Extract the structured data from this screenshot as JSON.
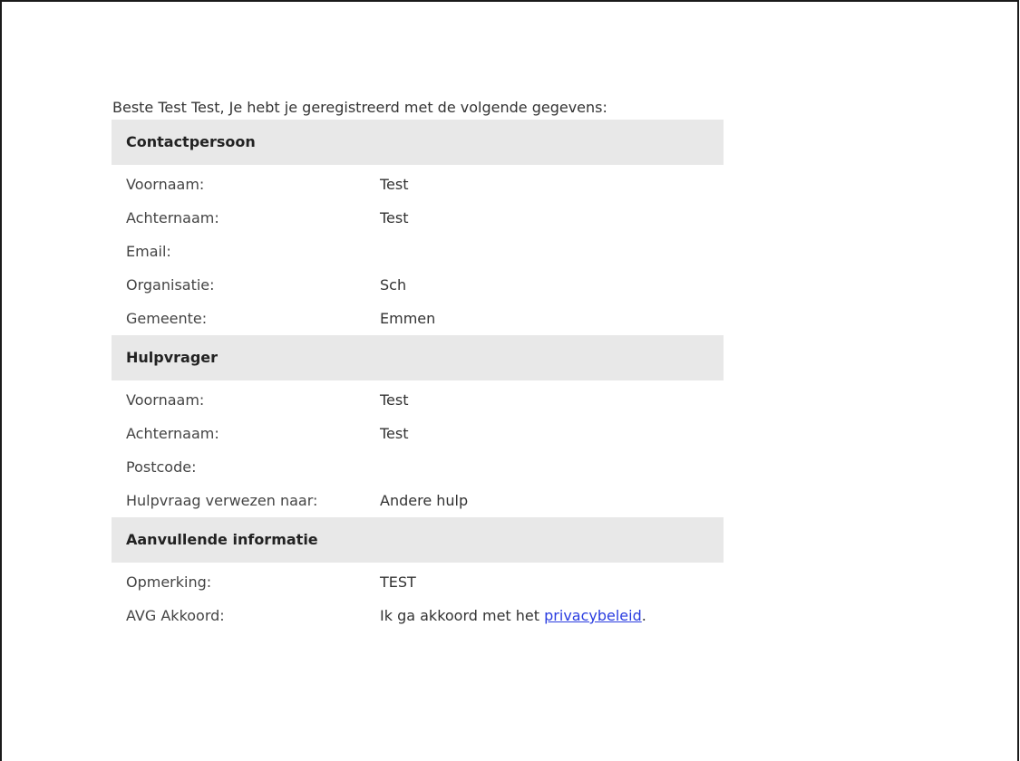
{
  "intro": "Beste Test Test, Je hebt je geregistreerd met de volgende gegevens:",
  "sections": [
    {
      "title": "Contactpersoon",
      "rows": [
        {
          "label": "Voornaam:",
          "value": "Test"
        },
        {
          "label": "Achternaam:",
          "value": "Test"
        },
        {
          "label": "Email:",
          "value": ""
        },
        {
          "label": "Organisatie:",
          "value": "Sch"
        },
        {
          "label": "Gemeente:",
          "value": "Emmen"
        }
      ]
    },
    {
      "title": "Hulpvrager",
      "rows": [
        {
          "label": "Voornaam:",
          "value": "Test"
        },
        {
          "label": "Achternaam:",
          "value": "Test"
        },
        {
          "label": "Postcode:",
          "value": ""
        },
        {
          "label": "Hulpvraag verwezen naar:",
          "value": "Andere hulp"
        }
      ]
    },
    {
      "title": "Aanvullende informatie",
      "rows": [
        {
          "label": "Opmerking:",
          "value": "TEST"
        },
        {
          "label": "AVG Akkoord:",
          "value_prefix": "Ik ga akkoord met het ",
          "link_text": "privacybeleid",
          "value_suffix": "."
        }
      ]
    }
  ],
  "colors": {
    "section_background": "#e8e8e8",
    "link": "#2a3de0",
    "frame_border": "#1a1a1a"
  }
}
